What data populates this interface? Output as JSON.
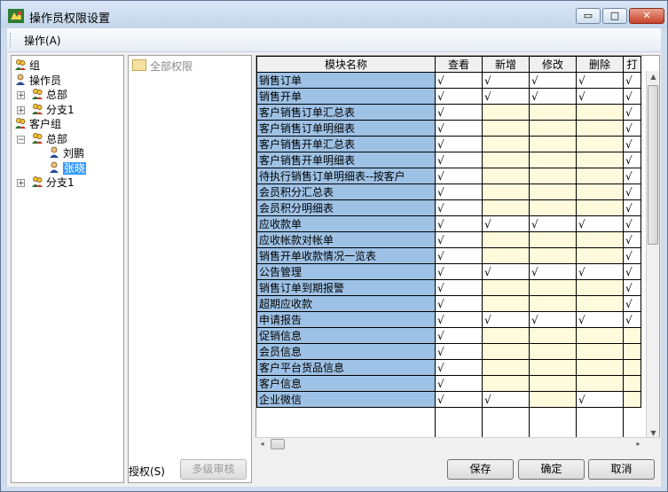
{
  "window": {
    "title": "操作员权限设置",
    "controls": {
      "minimize": "▭",
      "maximize": "□",
      "close": "✕"
    }
  },
  "menu": {
    "operate": "操作(A)"
  },
  "tree": {
    "nodes": [
      {
        "label": "组",
        "icon": "group-icon",
        "indent": 0,
        "expander": ""
      },
      {
        "label": "操作员",
        "icon": "user-icon",
        "indent": 0,
        "expander": ""
      },
      {
        "label": "总部",
        "icon": "group-icon",
        "indent": 1,
        "expander": "+"
      },
      {
        "label": "分支1",
        "icon": "group-icon",
        "indent": 1,
        "expander": "+"
      },
      {
        "label": "客户组",
        "icon": "group-icon",
        "indent": 0,
        "expander": ""
      },
      {
        "label": "总部",
        "icon": "group-icon",
        "indent": 1,
        "expander": "−"
      },
      {
        "label": "刘鹏",
        "icon": "user-icon",
        "indent": 2,
        "expander": ""
      },
      {
        "label": "张晓",
        "icon": "user-icon",
        "indent": 2,
        "expander": "",
        "selected": true
      },
      {
        "label": "分支1",
        "icon": "group-icon",
        "indent": 1,
        "expander": "+"
      }
    ]
  },
  "perm_tree": {
    "root": "全部权限"
  },
  "grid": {
    "columns": [
      "模块名称",
      "查看",
      "新增",
      "修改",
      "删除",
      "打"
    ],
    "check_mark": "√",
    "rows": [
      {
        "name": "销售订单",
        "cells": [
          "c",
          "c",
          "c",
          "c",
          "c"
        ]
      },
      {
        "name": "销售开单",
        "cells": [
          "c",
          "c",
          "c",
          "c",
          "c"
        ]
      },
      {
        "name": "客户销售订单汇总表",
        "cells": [
          "c",
          "d",
          "d",
          "d",
          "c"
        ]
      },
      {
        "name": "客户销售订单明细表",
        "cells": [
          "c",
          "d",
          "d",
          "d",
          "c"
        ]
      },
      {
        "name": "客户销售开单汇总表",
        "cells": [
          "c",
          "d",
          "d",
          "d",
          "c"
        ]
      },
      {
        "name": "客户销售开单明细表",
        "cells": [
          "c",
          "d",
          "d",
          "d",
          "c"
        ]
      },
      {
        "name": "待执行销售订单明细表--按客户",
        "cells": [
          "c",
          "d",
          "d",
          "d",
          "c"
        ]
      },
      {
        "name": "会员积分汇总表",
        "cells": [
          "c",
          "d",
          "d",
          "d",
          "c"
        ]
      },
      {
        "name": "会员积分明细表",
        "cells": [
          "c",
          "d",
          "d",
          "d",
          "c"
        ]
      },
      {
        "name": "应收款单",
        "cells": [
          "c",
          "c",
          "c",
          "c",
          "c"
        ]
      },
      {
        "name": "应收帐款对帐单",
        "cells": [
          "c",
          "d",
          "d",
          "d",
          "c"
        ]
      },
      {
        "name": "销售开单收款情况一览表",
        "cells": [
          "c",
          "d",
          "d",
          "d",
          "c"
        ]
      },
      {
        "name": "公告管理",
        "cells": [
          "c",
          "c",
          "c",
          "c",
          "c"
        ]
      },
      {
        "name": "销售订单到期报警",
        "cells": [
          "c",
          "d",
          "d",
          "d",
          "c"
        ]
      },
      {
        "name": "超期应收款",
        "cells": [
          "c",
          "d",
          "d",
          "d",
          "c"
        ]
      },
      {
        "name": "申请报告",
        "cells": [
          "c",
          "c",
          "c",
          "c",
          "c"
        ]
      },
      {
        "name": "促销信息",
        "cells": [
          "c",
          "d",
          "d",
          "d",
          "d"
        ]
      },
      {
        "name": "会员信息",
        "cells": [
          "c",
          "d",
          "d",
          "d",
          "d"
        ]
      },
      {
        "name": "客户平台货品信息",
        "cells": [
          "c",
          "d",
          "d",
          "d",
          "d"
        ]
      },
      {
        "name": "客户信息",
        "cells": [
          "c",
          "d",
          "d",
          "d",
          "d"
        ]
      },
      {
        "name": "企业微信",
        "cells": [
          "c",
          "c",
          "d",
          "c",
          "d"
        ]
      }
    ]
  },
  "footer": {
    "auth_label": "授权(S)",
    "review_button": "多级审核",
    "save_button": "保存",
    "ok_button": "确定",
    "cancel_button": "取消"
  },
  "colors": {
    "name_cell": "#9ec2e6",
    "disabled_cell": "#fdfbdc",
    "selection": "#3399ff"
  }
}
